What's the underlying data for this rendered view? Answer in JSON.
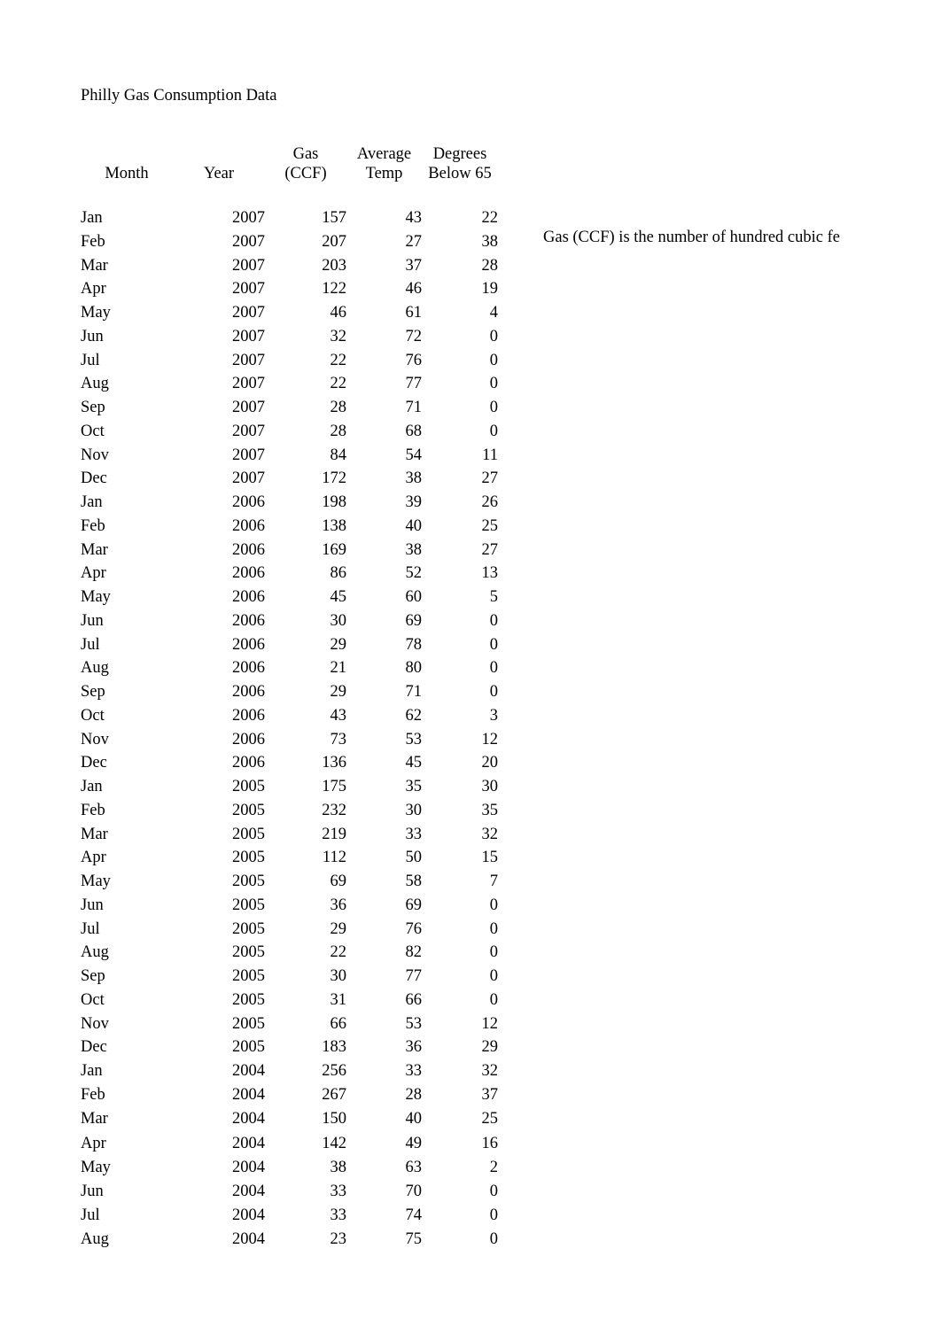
{
  "document": {
    "title": "Philly Gas Consumption Data",
    "side_note": "Gas (CCF) is the number of hundred cubic fe"
  },
  "table": {
    "columns": [
      {
        "key": "month",
        "label": "Month"
      },
      {
        "key": "year",
        "label": "Year"
      },
      {
        "key": "gas",
        "label": "Gas\n(CCF)"
      },
      {
        "key": "temp",
        "label": "Average\nTemp"
      },
      {
        "key": "degrees",
        "label": "Degrees\nBelow 65"
      }
    ],
    "rows": [
      {
        "month": "Jan",
        "year": "2007",
        "gas": "157",
        "temp": "43",
        "degrees": "22"
      },
      {
        "month": "Feb",
        "year": "2007",
        "gas": "207",
        "temp": "27",
        "degrees": "38"
      },
      {
        "month": "Mar",
        "year": "2007",
        "gas": "203",
        "temp": "37",
        "degrees": "28"
      },
      {
        "month": "Apr",
        "year": "2007",
        "gas": "122",
        "temp": "46",
        "degrees": "19"
      },
      {
        "month": "May",
        "year": "2007",
        "gas": "46",
        "temp": "61",
        "degrees": "4"
      },
      {
        "month": "Jun",
        "year": "2007",
        "gas": "32",
        "temp": "72",
        "degrees": "0"
      },
      {
        "month": "Jul",
        "year": "2007",
        "gas": "22",
        "temp": "76",
        "degrees": "0"
      },
      {
        "month": "Aug",
        "year": "2007",
        "gas": "22",
        "temp": "77",
        "degrees": "0"
      },
      {
        "month": "Sep",
        "year": "2007",
        "gas": "28",
        "temp": "71",
        "degrees": "0"
      },
      {
        "month": "Oct",
        "year": "2007",
        "gas": "28",
        "temp": "68",
        "degrees": "0"
      },
      {
        "month": "Nov",
        "year": "2007",
        "gas": "84",
        "temp": "54",
        "degrees": "11"
      },
      {
        "month": "Dec",
        "year": "2007",
        "gas": "172",
        "temp": "38",
        "degrees": "27"
      },
      {
        "month": "Jan",
        "year": "2006",
        "gas": "198",
        "temp": "39",
        "degrees": "26"
      },
      {
        "month": "Feb",
        "year": "2006",
        "gas": "138",
        "temp": "40",
        "degrees": "25"
      },
      {
        "month": "Mar",
        "year": "2006",
        "gas": "169",
        "temp": "38",
        "degrees": "27"
      },
      {
        "month": "Apr",
        "year": "2006",
        "gas": "86",
        "temp": "52",
        "degrees": "13"
      },
      {
        "month": "May",
        "year": "2006",
        "gas": "45",
        "temp": "60",
        "degrees": "5"
      },
      {
        "month": "Jun",
        "year": "2006",
        "gas": "30",
        "temp": "69",
        "degrees": "0"
      },
      {
        "month": "Jul",
        "year": "2006",
        "gas": "29",
        "temp": "78",
        "degrees": "0"
      },
      {
        "month": "Aug",
        "year": "2006",
        "gas": "21",
        "temp": "80",
        "degrees": "0"
      },
      {
        "month": "Sep",
        "year": "2006",
        "gas": "29",
        "temp": "71",
        "degrees": "0"
      },
      {
        "month": "Oct",
        "year": "2006",
        "gas": "43",
        "temp": "62",
        "degrees": "3"
      },
      {
        "month": "Nov",
        "year": "2006",
        "gas": "73",
        "temp": "53",
        "degrees": "12"
      },
      {
        "month": "Dec",
        "year": "2006",
        "gas": "136",
        "temp": "45",
        "degrees": "20"
      },
      {
        "month": "Jan",
        "year": "2005",
        "gas": "175",
        "temp": "35",
        "degrees": "30"
      },
      {
        "month": "Feb",
        "year": "2005",
        "gas": "232",
        "temp": "30",
        "degrees": "35"
      },
      {
        "month": "Mar",
        "year": "2005",
        "gas": "219",
        "temp": "33",
        "degrees": "32"
      },
      {
        "month": "Apr",
        "year": "2005",
        "gas": "112",
        "temp": "50",
        "degrees": "15"
      },
      {
        "month": "May",
        "year": "2005",
        "gas": "69",
        "temp": "58",
        "degrees": "7"
      },
      {
        "month": "Jun",
        "year": "2005",
        "gas": "36",
        "temp": "69",
        "degrees": "0"
      },
      {
        "month": "Jul",
        "year": "2005",
        "gas": "29",
        "temp": "76",
        "degrees": "0"
      },
      {
        "month": "Aug",
        "year": "2005",
        "gas": "22",
        "temp": "82",
        "degrees": "0"
      },
      {
        "month": "Sep",
        "year": "2005",
        "gas": "30",
        "temp": "77",
        "degrees": "0"
      },
      {
        "month": "Oct",
        "year": "2005",
        "gas": "31",
        "temp": "66",
        "degrees": "0"
      },
      {
        "month": "Nov",
        "year": "2005",
        "gas": "66",
        "temp": "53",
        "degrees": "12"
      },
      {
        "month": "Dec",
        "year": "2005",
        "gas": "183",
        "temp": "36",
        "degrees": "29"
      },
      {
        "month": "Jan",
        "year": "2004",
        "gas": "256",
        "temp": "33",
        "degrees": "32"
      },
      {
        "month": "Feb",
        "year": "2004",
        "gas": "267",
        "temp": "28",
        "degrees": "37"
      },
      {
        "month": "Mar",
        "year": "2004",
        "gas": "150",
        "temp": "40",
        "degrees": "25"
      },
      {
        "month": "Apr",
        "year": "2004",
        "gas": "142",
        "temp": "49",
        "degrees": "16"
      },
      {
        "month": "May",
        "year": "2004",
        "gas": "38",
        "temp": "63",
        "degrees": "2"
      },
      {
        "month": "Jun",
        "year": "2004",
        "gas": "33",
        "temp": "70",
        "degrees": "0"
      },
      {
        "month": "Jul",
        "year": "2004",
        "gas": "33",
        "temp": "74",
        "degrees": "0"
      },
      {
        "month": "Aug",
        "year": "2004",
        "gas": "23",
        "temp": "75",
        "degrees": "0"
      }
    ]
  }
}
